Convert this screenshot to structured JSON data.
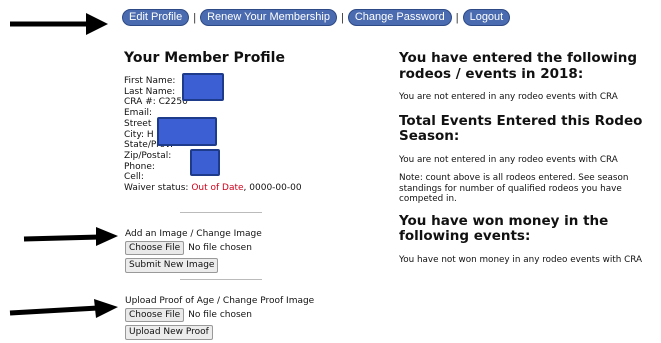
{
  "nav": {
    "edit_profile": "Edit Profile",
    "renew": "Renew Your Membership",
    "change_password": "Change Password",
    "logout": "Logout",
    "separator": "|"
  },
  "profile": {
    "title": "Your Member Profile",
    "first_name_label": "First Name:",
    "last_name_label": "Last Name:",
    "cra_label": "CRA #: C2250",
    "email_label": "Email:",
    "street_label": "Street",
    "city_label": "City: H",
    "state_label": "State/Prov:",
    "zip_label": "Zip/Postal:",
    "phone_label": "Phone:",
    "cell_label": "Cell:",
    "waiver_label": "Waiver status: ",
    "waiver_status": "Out of Date",
    "waiver_date": ", 0000-00-00"
  },
  "image_upload": {
    "label": "Add an Image / Change Image",
    "choose_file": "Choose File",
    "no_file": "No file chosen",
    "submit": "Submit New Image"
  },
  "proof_upload": {
    "label": "Upload Proof of Age / Change Proof Image",
    "choose_file": "Choose File",
    "no_file": "No file chosen",
    "submit": "Upload New Proof"
  },
  "right": {
    "entered_title": "You have entered the following rodeos / events in 2018:",
    "entered_text": "You are not entered in any rodeo events with CRA",
    "total_title": "Total Events Entered this Rodeo Season:",
    "total_text": "You are not entered in any rodeo events with CRA",
    "note_text": "Note: count above is all rodeos entered. See season standings for number of qualified rodeos you have competed in.",
    "won_title": "You have won money in the following events:",
    "won_text": "You have not won money in any rodeo events with CRA"
  },
  "colors": {
    "nav_button": "#4a6bb0",
    "waiver_bad": "#d0021b",
    "redaction": "#3c5fd4"
  }
}
